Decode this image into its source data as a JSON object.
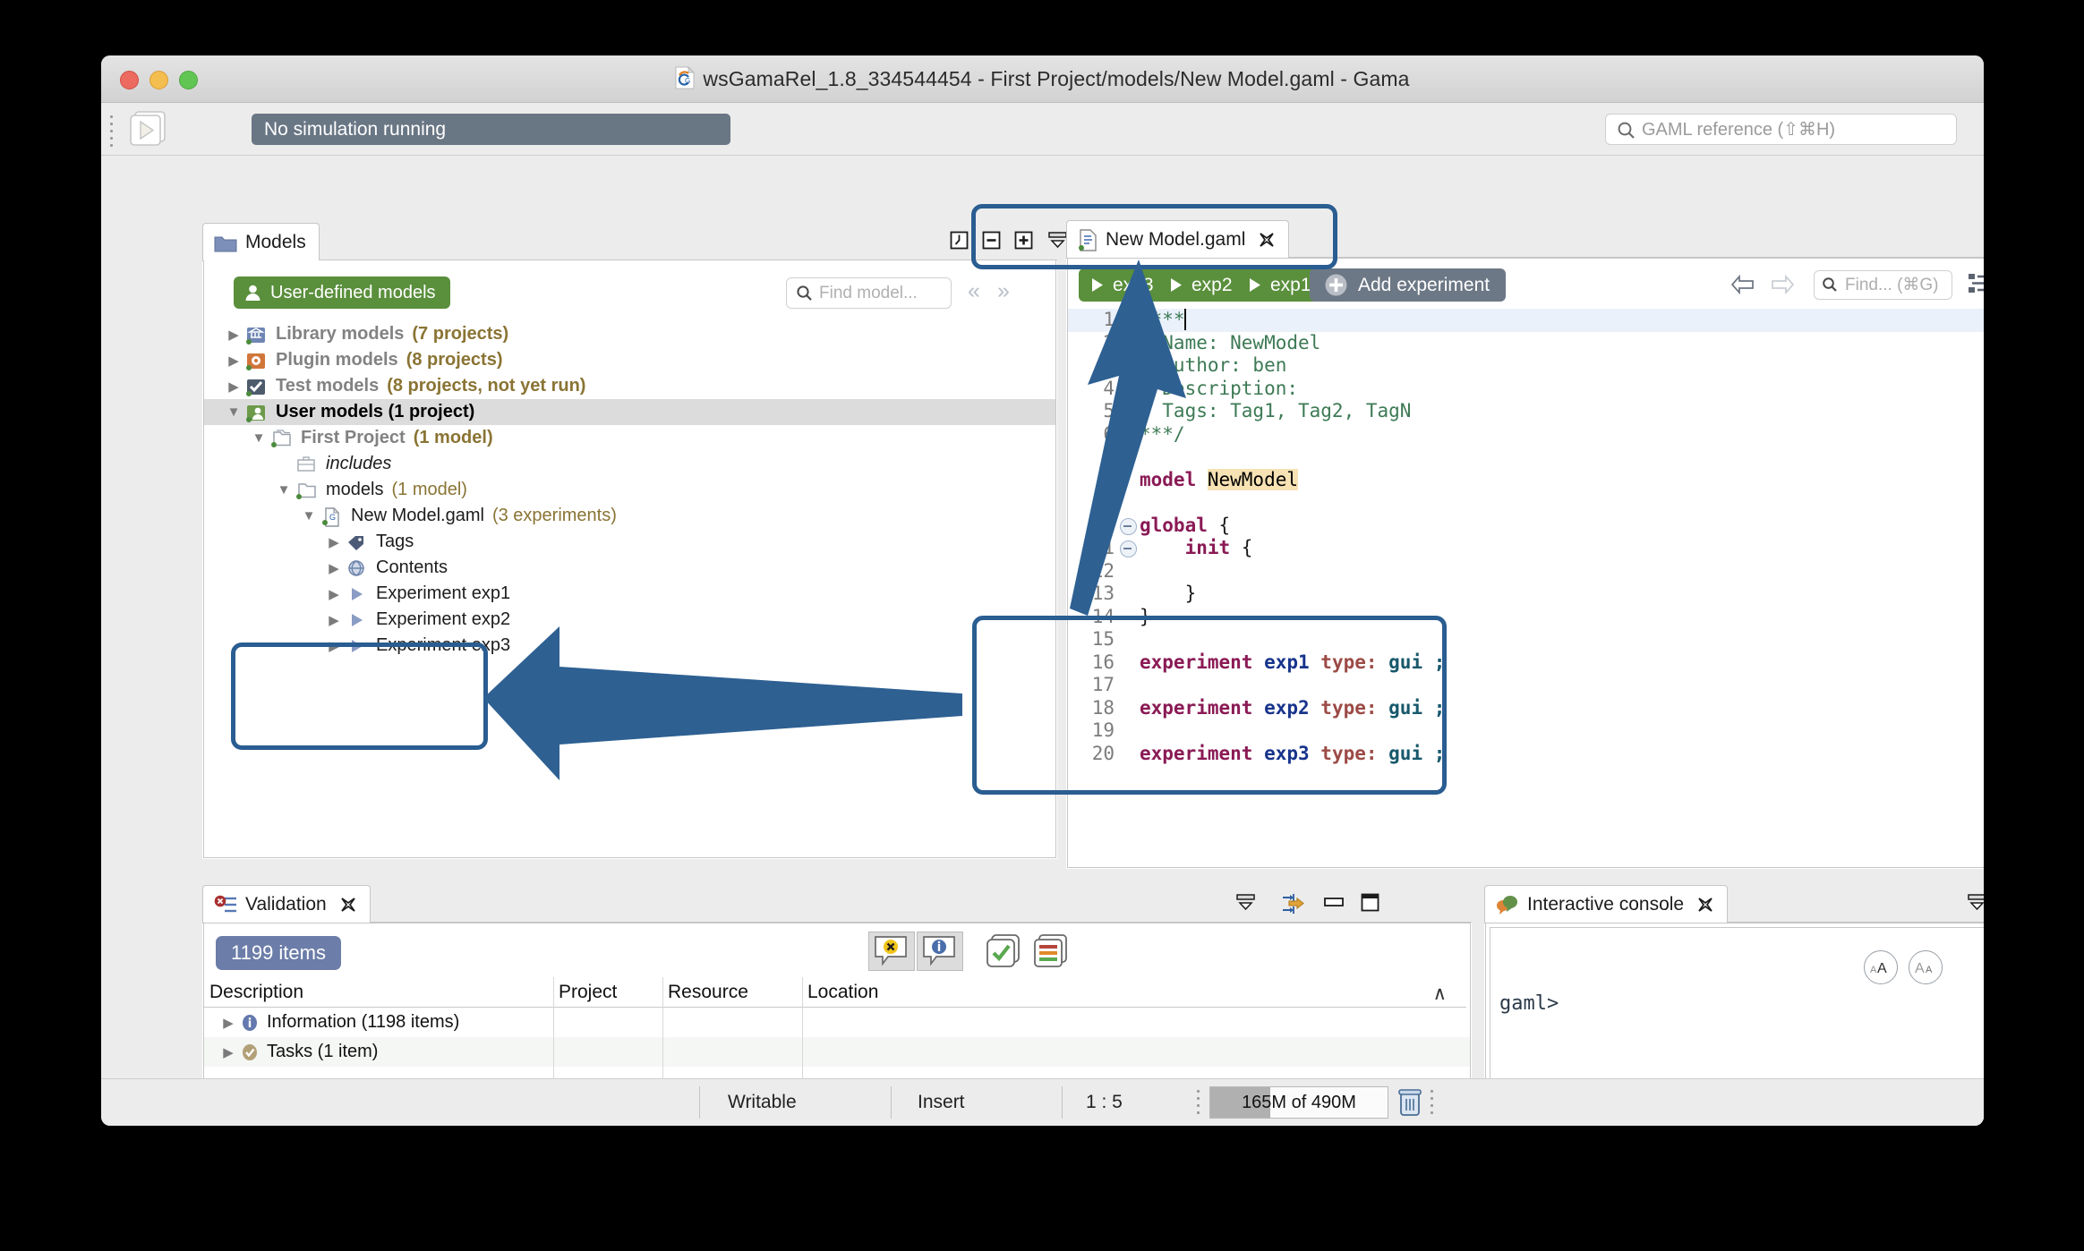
{
  "window": {
    "title": "wsGamaRel_1.8_334544454 - First Project/models/New Model.gaml - Gama",
    "title_icon": "gama-logo-icon"
  },
  "command_bar": {
    "run_icon": "play-button-icon",
    "status_text": "No simulation running",
    "search": {
      "icon": "search-icon",
      "placeholder": "GAML reference (⇧⌘H)",
      "value": ""
    }
  },
  "models_panel": {
    "tab": {
      "label": "Models",
      "icon": "folder-icon"
    },
    "toolbar_icons": [
      "history-icon",
      "collapse-all-icon",
      "expand-all-icon",
      "minimize-panel-icon",
      "minimize-icon",
      "maximize-icon"
    ],
    "user_defined_badge": {
      "label": "User-defined models",
      "icon": "user-icon"
    },
    "find": {
      "icon": "search-icon",
      "placeholder": "Find model...",
      "value": ""
    },
    "nav_prev_icon": "chevron-left-double-icon",
    "nav_next_icon": "chevron-right-double-icon",
    "tree": [
      {
        "indent": 0,
        "twisty": "collapsed",
        "icon": "library-models-icon",
        "label": "Library models",
        "suffix": "(7 projects)",
        "style": "gray"
      },
      {
        "indent": 0,
        "twisty": "collapsed",
        "icon": "plugin-models-icon",
        "label": "Plugin models",
        "suffix": "(8 projects)",
        "style": "gray"
      },
      {
        "indent": 0,
        "twisty": "collapsed",
        "icon": "test-models-icon",
        "label": "Test models",
        "suffix": "(8 projects, not yet run)",
        "style": "gray"
      },
      {
        "indent": 0,
        "twisty": "expanded",
        "icon": "user-models-icon",
        "label": "User models (1 project)",
        "suffix": "",
        "style": "selected"
      },
      {
        "indent": 1,
        "twisty": "expanded",
        "icon": "project-folder-icon",
        "label": "First Project",
        "suffix": "(1 model)",
        "style": "gray"
      },
      {
        "indent": 2,
        "twisty": "none",
        "icon": "includes-folder-icon",
        "label": "includes",
        "suffix": "",
        "style": "italic"
      },
      {
        "indent": 2,
        "twisty": "expanded",
        "icon": "models-folder-icon",
        "label": "models",
        "suffix": "(1 model)",
        "style": "plain"
      },
      {
        "indent": 3,
        "twisty": "expanded",
        "icon": "gaml-file-icon",
        "label": "New Model.gaml",
        "suffix": "(3 experiments)",
        "style": "plain"
      },
      {
        "indent": 4,
        "twisty": "collapsed",
        "icon": "tag-icon",
        "label": "Tags",
        "suffix": "",
        "style": "plain"
      },
      {
        "indent": 4,
        "twisty": "collapsed",
        "icon": "contents-globe-icon",
        "label": "Contents",
        "suffix": "",
        "style": "plain"
      },
      {
        "indent": 4,
        "twisty": "collapsed",
        "icon": "experiment-play-icon",
        "label": "Experiment exp1",
        "suffix": "",
        "style": "plain"
      },
      {
        "indent": 4,
        "twisty": "collapsed",
        "icon": "experiment-play-icon",
        "label": "Experiment exp2",
        "suffix": "",
        "style": "plain"
      },
      {
        "indent": 4,
        "twisty": "collapsed",
        "icon": "experiment-play-icon",
        "label": "Experiment exp3",
        "suffix": "",
        "style": "plain"
      }
    ]
  },
  "editor_panel": {
    "tab": {
      "label": "New Model.gaml",
      "icon": "gaml-file-icon",
      "close_icon": "close-icon"
    },
    "minimize_icon": "minimize-icon",
    "maximize_icon": "maximize-icon",
    "experiment_buttons": [
      {
        "label": "exp3",
        "icon": "play-icon"
      },
      {
        "label": "exp2",
        "icon": "play-icon"
      },
      {
        "label": "exp1",
        "icon": "play-icon"
      }
    ],
    "add_experiment": {
      "label": "Add experiment",
      "icon": "plus-circle-icon"
    },
    "back_icon": "arrow-left-icon",
    "forward_icon": "arrow-right-icon",
    "find": {
      "icon": "search-icon",
      "placeholder": "Find... (⌘G)",
      "value": ""
    },
    "outline_icon": "outline-list-icon",
    "dropdown_icon": "chevron-down-icon",
    "code_lines": [
      {
        "n": 1,
        "fold": true,
        "tokens": [
          {
            "t": "/***",
            "c": "cm"
          }
        ],
        "current": true,
        "caret": true
      },
      {
        "n": 2,
        "fold": false,
        "tokens": [
          {
            "t": "* Name: NewModel",
            "c": "cm"
          }
        ]
      },
      {
        "n": 3,
        "fold": false,
        "tokens": [
          {
            "t": "* Author: ben",
            "c": "cm"
          }
        ]
      },
      {
        "n": 4,
        "fold": false,
        "tokens": [
          {
            "t": "* Description: ",
            "c": "cm"
          }
        ]
      },
      {
        "n": 5,
        "fold": false,
        "tokens": [
          {
            "t": "* Tags: Tag1, Tag2, TagN",
            "c": "cm"
          }
        ]
      },
      {
        "n": 6,
        "fold": false,
        "tokens": [
          {
            "t": "***/",
            "c": "cm"
          }
        ]
      },
      {
        "n": 7,
        "fold": false,
        "tokens": []
      },
      {
        "n": 8,
        "fold": false,
        "tokens": [
          {
            "t": "model ",
            "c": "kw"
          },
          {
            "t": "NewModel",
            "c": "hl"
          }
        ]
      },
      {
        "n": 9,
        "fold": false,
        "tokens": []
      },
      {
        "n": 10,
        "fold": true,
        "tokens": [
          {
            "t": "global ",
            "c": "kw"
          },
          {
            "t": "{",
            "c": "nm"
          }
        ]
      },
      {
        "n": 11,
        "fold": true,
        "tokens": [
          {
            "t": "    init ",
            "c": "kw"
          },
          {
            "t": "{",
            "c": "nm"
          }
        ]
      },
      {
        "n": 12,
        "fold": false,
        "tokens": []
      },
      {
        "n": 13,
        "fold": false,
        "tokens": [
          {
            "t": "    }",
            "c": "nm"
          }
        ]
      },
      {
        "n": 14,
        "fold": false,
        "tokens": [
          {
            "t": "}",
            "c": "nm"
          }
        ]
      },
      {
        "n": 15,
        "fold": false,
        "tokens": []
      },
      {
        "n": 16,
        "fold": false,
        "tokens": [
          {
            "t": "experiment ",
            "c": "kw"
          },
          {
            "t": "exp1 ",
            "c": "id"
          },
          {
            "t": "type: ",
            "c": "at"
          },
          {
            "t": "gui ",
            "c": "vl"
          },
          {
            "t": ";",
            "c": "vl"
          }
        ]
      },
      {
        "n": 17,
        "fold": false,
        "tokens": []
      },
      {
        "n": 18,
        "fold": false,
        "tokens": [
          {
            "t": "experiment ",
            "c": "kw"
          },
          {
            "t": "exp2 ",
            "c": "id"
          },
          {
            "t": "type: ",
            "c": "at"
          },
          {
            "t": "gui ",
            "c": "vl"
          },
          {
            "t": ";",
            "c": "vl"
          }
        ]
      },
      {
        "n": 19,
        "fold": false,
        "tokens": []
      },
      {
        "n": 20,
        "fold": false,
        "tokens": [
          {
            "t": "experiment ",
            "c": "kw"
          },
          {
            "t": "exp3 ",
            "c": "id"
          },
          {
            "t": "type: ",
            "c": "at"
          },
          {
            "t": "gui ",
            "c": "vl"
          },
          {
            "t": ";",
            "c": "vl"
          }
        ]
      }
    ]
  },
  "validation_panel": {
    "tab": {
      "label": "Validation",
      "icon": "validation-icon",
      "close_icon": "close-icon"
    },
    "toolbar_icons": [
      "minimize-panel-icon",
      "go-to-marker-icon",
      "minimize-icon",
      "maximize-icon"
    ],
    "filter_icons": [
      "error-filter-icon",
      "info-filter-icon",
      "check-filter-icon",
      "severity-list-icon"
    ],
    "items_badge": "1199 items",
    "columns": [
      "Description",
      "Project",
      "Resource",
      "Location"
    ],
    "sort_icon": "sort-ascending-icon",
    "rows": [
      {
        "description": "Information (1198 items)",
        "icon": "info-icon",
        "project": "",
        "resource": "",
        "location": ""
      },
      {
        "description": "Tasks (1 item)",
        "icon": "task-icon",
        "project": "",
        "resource": "",
        "location": ""
      }
    ]
  },
  "console_panel": {
    "tab": {
      "label": "Interactive console",
      "icon": "console-chat-icon",
      "close_icon": "close-icon"
    },
    "toolbar_icons": [
      "minimize-panel-icon",
      "minimize-icon",
      "maximize-icon"
    ],
    "font_buttons": [
      "increase-font-icon",
      "decrease-font-icon",
      "reset-font-icon"
    ],
    "prompt": "gaml>"
  },
  "status_bar": {
    "writable": "Writable",
    "insert": "Insert",
    "position": "1 : 5",
    "heap": "165M of 490M",
    "heap_percent": 34,
    "trash_icon": "trash-icon"
  },
  "colors": {
    "accent_green": "#5a8f3c",
    "annotation_blue": "#2a5d91",
    "status_gray": "#697684",
    "badge_blue": "#6b7da8"
  }
}
